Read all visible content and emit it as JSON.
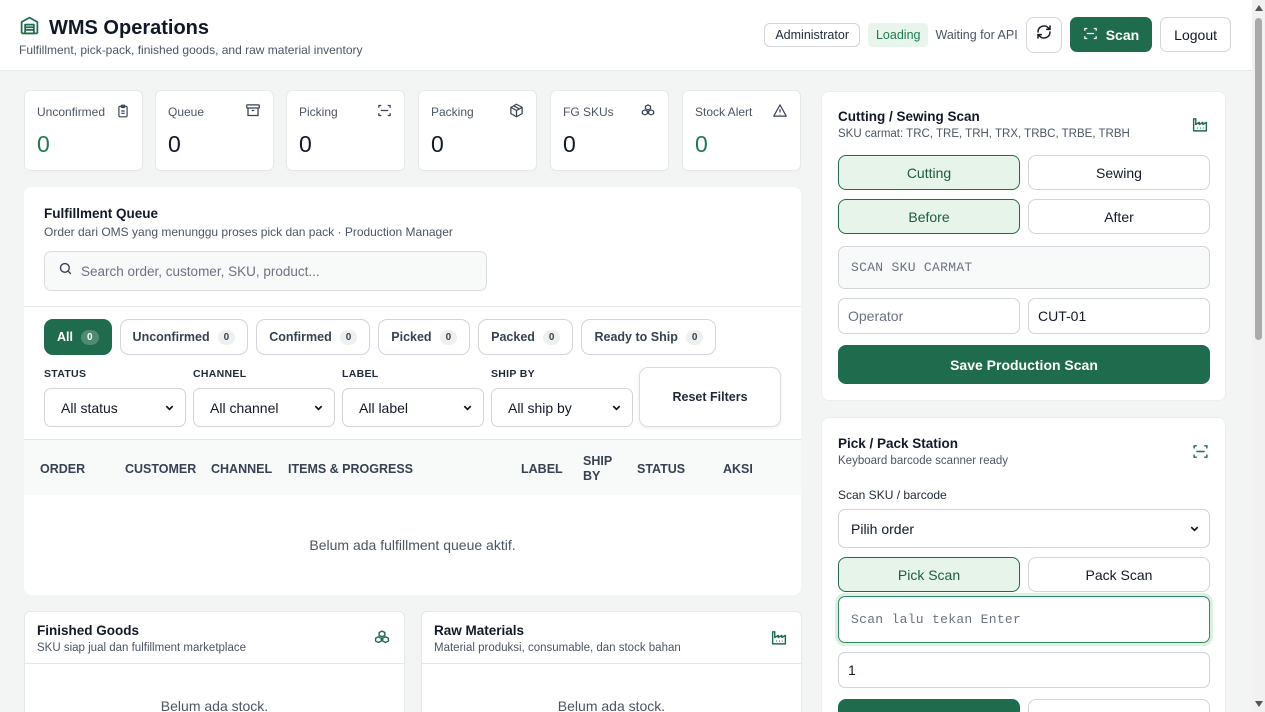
{
  "header": {
    "title": "WMS Operations",
    "subtitle": "Fulfillment, pick-pack, finished goods, and raw material inventory",
    "role": "Administrator",
    "status": "Loading",
    "status_detail": "Waiting for API",
    "scan_label": "Scan",
    "logout_label": "Logout"
  },
  "stats": [
    {
      "label": "Unconfirmed",
      "value": "0",
      "icon": "clipboard-icon"
    },
    {
      "label": "Queue",
      "value": "0",
      "icon": "archive-icon"
    },
    {
      "label": "Picking",
      "value": "0",
      "icon": "scan-icon"
    },
    {
      "label": "Packing",
      "value": "0",
      "icon": "package-icon"
    },
    {
      "label": "FG SKUs",
      "value": "0",
      "icon": "boxes-icon"
    },
    {
      "label": "Stock Alert",
      "value": "0",
      "icon": "alert-triangle-icon"
    }
  ],
  "queue": {
    "title": "Fulfillment Queue",
    "subtitle": "Order dari OMS yang menunggu proses pick dan pack · Production Manager",
    "search_placeholder": "Search order, customer, SKU, product...",
    "chips": [
      {
        "label": "All",
        "count": "0"
      },
      {
        "label": "Unconfirmed",
        "count": "0"
      },
      {
        "label": "Confirmed",
        "count": "0"
      },
      {
        "label": "Picked",
        "count": "0"
      },
      {
        "label": "Packed",
        "count": "0"
      },
      {
        "label": "Ready to Ship",
        "count": "0"
      }
    ],
    "filters": [
      {
        "label": "STATUS",
        "value": "All status"
      },
      {
        "label": "CHANNEL",
        "value": "All channel"
      },
      {
        "label": "LABEL",
        "value": "All label"
      },
      {
        "label": "SHIP BY",
        "value": "All ship by"
      }
    ],
    "reset_label": "Reset Filters",
    "columns": [
      "ORDER",
      "CUSTOMER",
      "CHANNEL",
      "ITEMS & PROGRESS",
      "LABEL",
      "SHIP",
      "BY",
      "STATUS",
      "AKSI"
    ],
    "empty": "Belum ada fulfillment queue aktif."
  },
  "finished_goods": {
    "title": "Finished Goods",
    "subtitle": "SKU siap jual dan fulfillment marketplace",
    "empty": "Belum ada stock."
  },
  "raw_materials": {
    "title": "Raw Materials",
    "subtitle": "Material produksi, consumable, dan stock bahan",
    "empty": "Belum ada stock."
  },
  "production": {
    "title": "Cutting / Sewing Scan",
    "subtitle": "SKU carmat: TRC, TRE, TRH, TRX, TRBC, TRBE, TRBH",
    "stage_options": [
      "Cutting",
      "Sewing"
    ],
    "phase_options": [
      "Before",
      "After"
    ],
    "sku_placeholder": "SCAN SKU CARMAT",
    "operator_placeholder": "Operator",
    "station_value": "CUT-01",
    "save_label": "Save Production Scan"
  },
  "pickpack": {
    "title": "Pick / Pack Station",
    "subtitle": "Keyboard barcode scanner ready",
    "scan_label": "Scan SKU / barcode",
    "order_select": "Pilih order",
    "mode_options": [
      "Pick Scan",
      "Pack Scan"
    ],
    "scan_placeholder": "Scan lalu tekan Enter",
    "qty_value": "1"
  },
  "colors": {
    "accent": "#1e6b4d",
    "accent_light": "#e6f4ea",
    "status_green": "#1e7a4e"
  }
}
